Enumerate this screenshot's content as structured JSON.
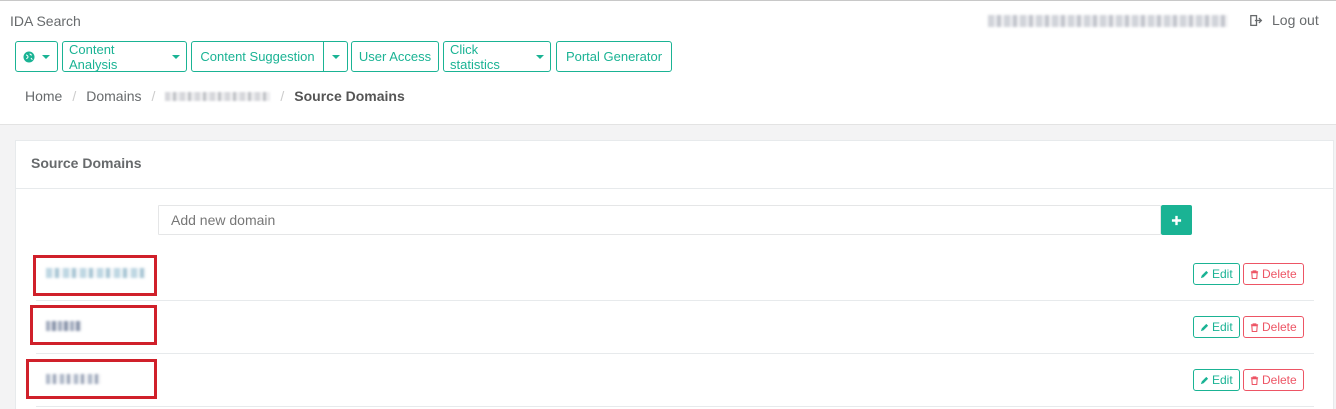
{
  "app": {
    "title": "IDA Search"
  },
  "header": {
    "logout_label": "Log out",
    "icons": [
      "logout-icon"
    ]
  },
  "toolbar": {
    "globe_icon": "globe-icon",
    "content_analysis": "Content Analysis",
    "content_suggestion": "Content Suggestion",
    "user_access": "User Access",
    "click_statistics": "Click statistics",
    "portal_generator": "Portal Generator"
  },
  "breadcrumb": {
    "home": "Home",
    "domains": "Domains",
    "separator": "/",
    "current": "Source Domains"
  },
  "panel": {
    "title": "Source Domains",
    "add_placeholder": "Add new domain",
    "add_icon": "plus-icon"
  },
  "rows": {
    "edit_label": "Edit",
    "delete_label": "Delete",
    "edit_icon": "pencil-icon",
    "delete_icon": "trash-icon"
  },
  "colors": {
    "accent": "#1ab394",
    "danger": "#ed5565",
    "highlight": "#d0202a"
  }
}
